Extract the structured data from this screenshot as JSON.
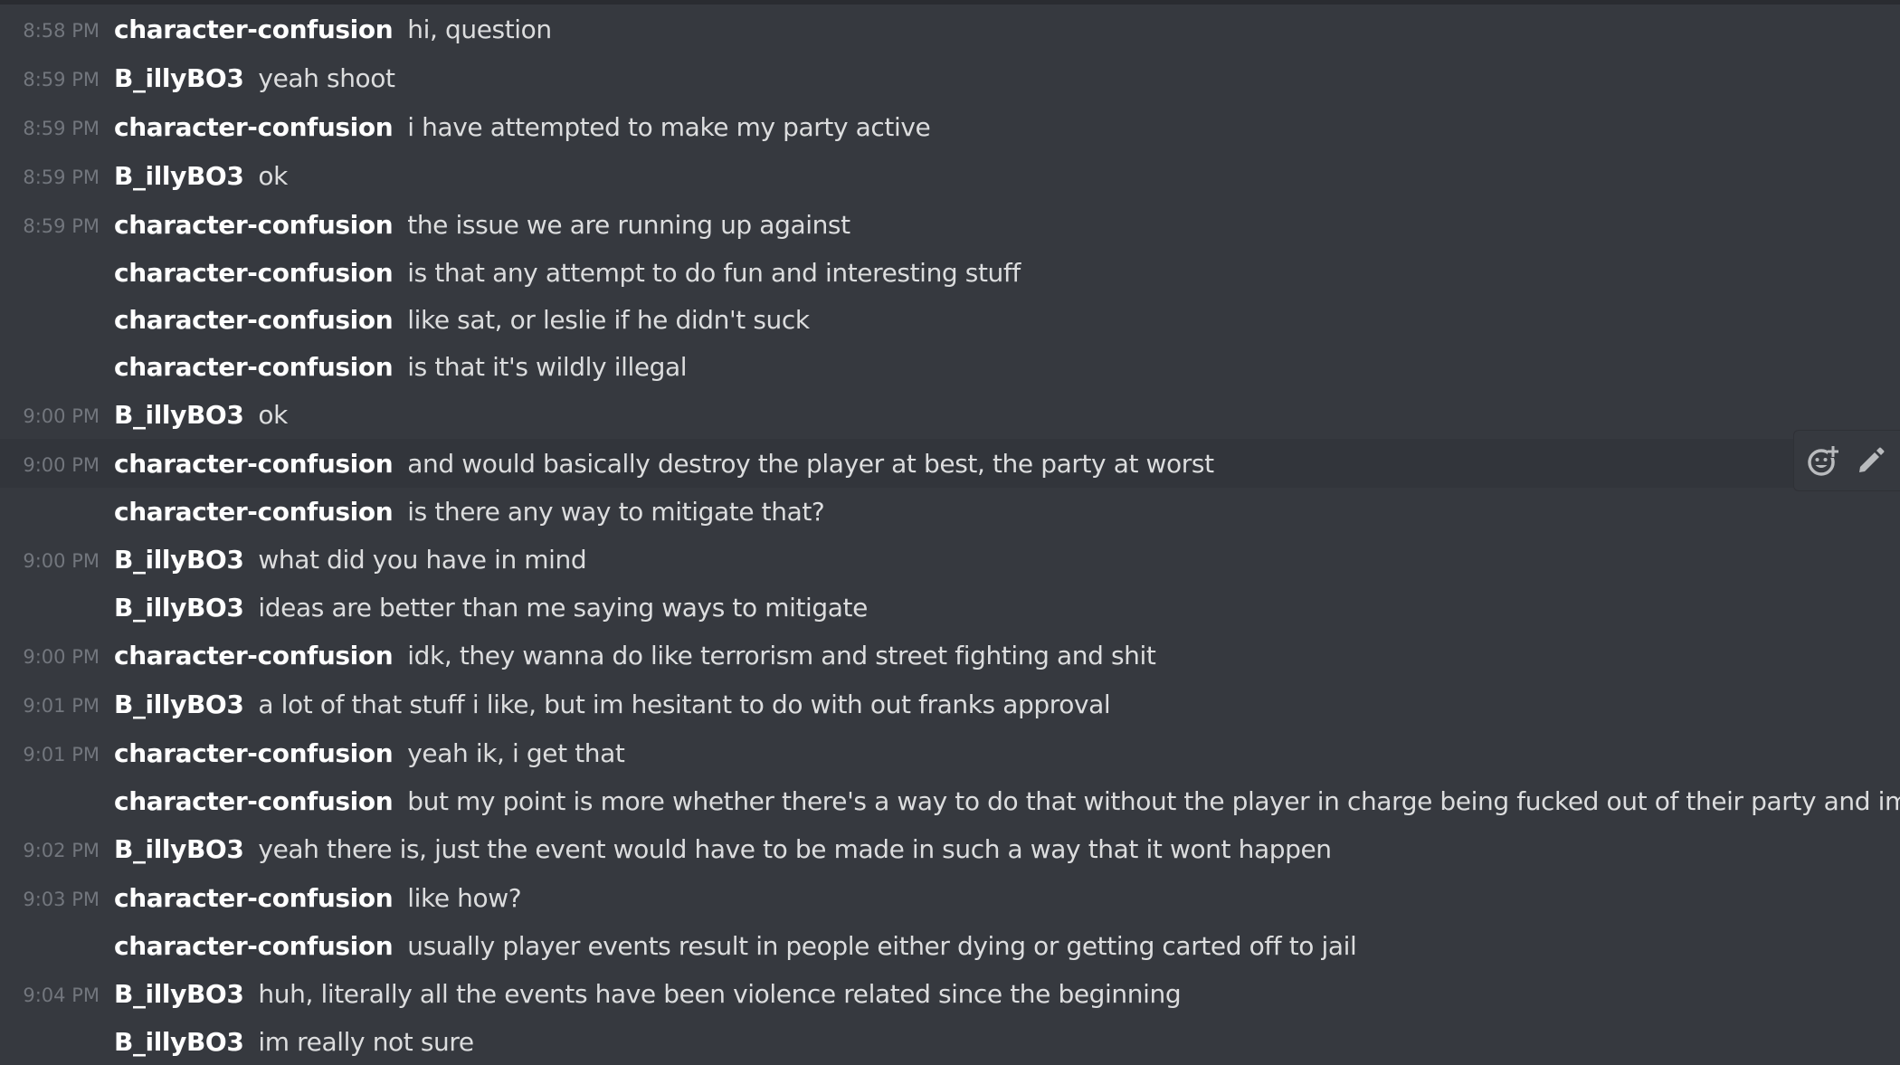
{
  "messages": [
    {
      "time": "8:58 PM",
      "author": "character-confusion",
      "text": "hi, question"
    },
    {
      "time": "8:59 PM",
      "author": "B_illyBO3",
      "text": "yeah shoot"
    },
    {
      "time": "8:59 PM",
      "author": "character-confusion",
      "text": "i have attempted to make my party active"
    },
    {
      "time": "8:59 PM",
      "author": "B_illyBO3",
      "text": "ok"
    },
    {
      "time": "8:59 PM",
      "author": "character-confusion",
      "text": "the issue we are running up against"
    },
    {
      "time": "",
      "author": "character-confusion",
      "text": "is that any attempt to do fun and interesting stuff"
    },
    {
      "time": "",
      "author": "character-confusion",
      "text": "like sat, or leslie if he didn't suck"
    },
    {
      "time": "",
      "author": "character-confusion",
      "text": "is that it's wildly illegal"
    },
    {
      "time": "9:00 PM",
      "author": "B_illyBO3",
      "text": "ok"
    },
    {
      "time": "9:00 PM",
      "author": "character-confusion",
      "text": "and would basically destroy the player at best, the party at worst"
    },
    {
      "time": "",
      "author": "character-confusion",
      "text": "is there any way to mitigate that?"
    },
    {
      "time": "9:00 PM",
      "author": "B_illyBO3",
      "text": "what did you have in mind"
    },
    {
      "time": "",
      "author": "B_illyBO3",
      "text": "ideas are better than me saying ways to mitigate"
    },
    {
      "time": "9:00 PM",
      "author": "character-confusion",
      "text": "idk, they wanna do like terrorism and street fighting and shit"
    },
    {
      "time": "9:01 PM",
      "author": "B_illyBO3",
      "text": "a lot of that stuff i like, but im hesitant to do with out franks approval"
    },
    {
      "time": "9:01 PM",
      "author": "character-confusion",
      "text": "yeah ik, i get that"
    },
    {
      "time": "",
      "author": "character-confusion",
      "text": "but my point is more whether there's a way to do that without the player in charge being fucked out of their party and image"
    },
    {
      "time": "9:02 PM",
      "author": "B_illyBO3",
      "text": "yeah there is, just the event would have to be made in such a way that it wont happen"
    },
    {
      "time": "9:03 PM",
      "author": "character-confusion",
      "text": "like how?"
    },
    {
      "time": "",
      "author": "character-confusion",
      "text": "usually player events result in people either dying or getting carted off to jail"
    },
    {
      "time": "9:04 PM",
      "author": "B_illyBO3",
      "text": "huh, literally all the events have been violence related since the beginning"
    },
    {
      "time": "",
      "author": "B_illyBO3",
      "text": "im really not sure"
    }
  ],
  "hover_actions": {
    "reaction_icon": "add-reaction-icon",
    "edit_icon": "pencil-icon"
  },
  "colors": {
    "background": "#36393f",
    "hover_row": "#32353b",
    "author": "#ffffff",
    "text": "#dcddde",
    "timestamp": "#72767d"
  }
}
